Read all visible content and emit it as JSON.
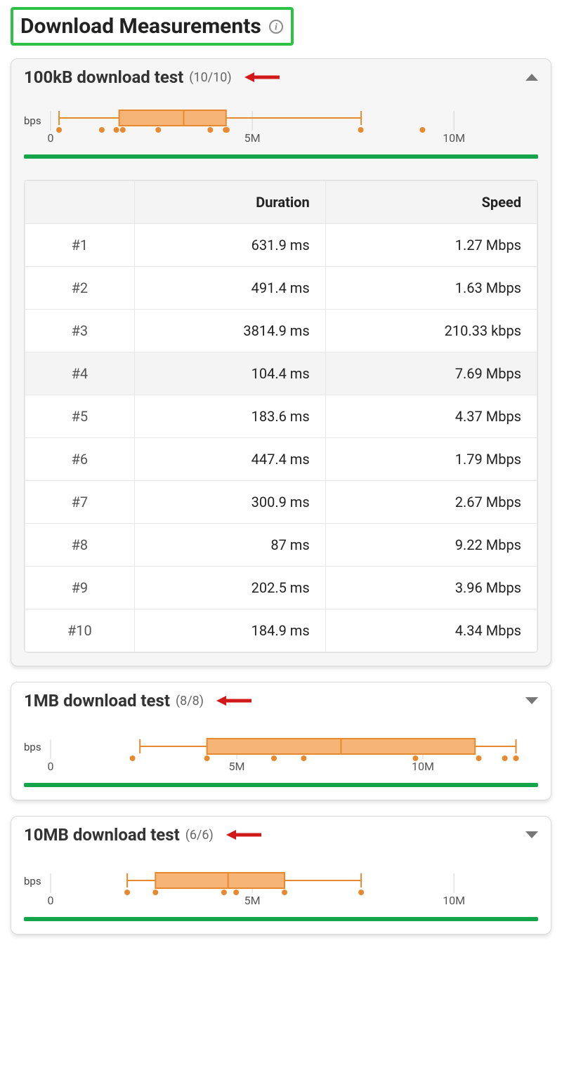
{
  "title": "Download Measurements",
  "chart_data": [
    {
      "type": "boxplot",
      "title": "100kB download test",
      "ylabel": "bps",
      "xlim": [
        0,
        12000000
      ],
      "ticks": [
        0,
        5000000,
        10000000
      ],
      "tick_labels": [
        "0",
        "5M",
        "10M"
      ],
      "q1": 1700000,
      "median": 3300000,
      "q3": 4350000,
      "whisker_low": 210000,
      "whisker_high": 7700000,
      "points": [
        210330,
        1270000,
        1630000,
        1790000,
        2670000,
        3960000,
        4340000,
        4370000,
        7690000,
        9220000
      ]
    },
    {
      "type": "boxplot",
      "title": "1MB download test",
      "ylabel": "bps",
      "xlim": [
        0,
        13000000
      ],
      "ticks": [
        0,
        5000000,
        10000000
      ],
      "tick_labels": [
        "0",
        "5M",
        "10M"
      ],
      "q1": 4200000,
      "median": 7800000,
      "q3": 11400000,
      "whisker_low": 2400000,
      "whisker_high": 12500000,
      "points": [
        2200000,
        4200000,
        6000000,
        6800000,
        9800000,
        11500000,
        12200000,
        12500000
      ]
    },
    {
      "type": "boxplot",
      "title": "10MB download test",
      "ylabel": "bps",
      "xlim": [
        0,
        12000000
      ],
      "ticks": [
        0,
        5000000,
        10000000
      ],
      "tick_labels": [
        "0",
        "5M",
        "10M"
      ],
      "q1": 2600000,
      "median": 4400000,
      "q3": 5800000,
      "whisker_low": 1900000,
      "whisker_high": 7700000,
      "points": [
        1900000,
        2600000,
        4300000,
        4600000,
        5800000,
        7700000
      ]
    }
  ],
  "tests": [
    {
      "title": "100kB download test",
      "count": "(10/10)",
      "expanded": true,
      "chart_index": 0
    },
    {
      "title": "1MB download test",
      "count": "(8/8)",
      "expanded": false,
      "chart_index": 1
    },
    {
      "title": "10MB download test",
      "count": "(6/6)",
      "expanded": false,
      "chart_index": 2
    }
  ],
  "table": {
    "headers": [
      "",
      "Duration",
      "Speed"
    ],
    "rows": [
      {
        "idx": "#1",
        "dur": "631.9 ms",
        "spd": "1.27 Mbps"
      },
      {
        "idx": "#2",
        "dur": "491.4 ms",
        "spd": "1.63 Mbps"
      },
      {
        "idx": "#3",
        "dur": "3814.9 ms",
        "spd": "210.33 kbps"
      },
      {
        "idx": "#4",
        "dur": "104.4 ms",
        "spd": "7.69 Mbps",
        "highlight": true
      },
      {
        "idx": "#5",
        "dur": "183.6 ms",
        "spd": "4.37 Mbps"
      },
      {
        "idx": "#6",
        "dur": "447.4 ms",
        "spd": "1.79 Mbps"
      },
      {
        "idx": "#7",
        "dur": "300.9 ms",
        "spd": "2.67 Mbps"
      },
      {
        "idx": "#8",
        "dur": "87 ms",
        "spd": "9.22 Mbps"
      },
      {
        "idx": "#9",
        "dur": "202.5 ms",
        "spd": "3.96 Mbps"
      },
      {
        "idx": "#10",
        "dur": "184.9 ms",
        "spd": "4.34 Mbps"
      }
    ]
  }
}
